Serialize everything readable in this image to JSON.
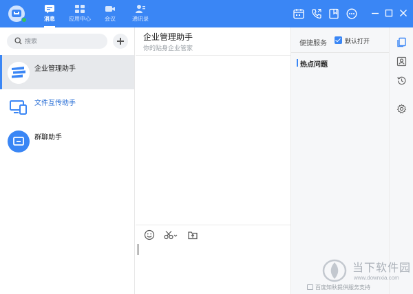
{
  "colors": {
    "brand": "#3a86f5",
    "online": "#33c25a",
    "selected_bg": "#e7e9ec"
  },
  "app": {
    "logo_icon": "chat-bubble-logo-icon",
    "status": "online"
  },
  "nav": [
    {
      "label": "消息",
      "icon": "message-icon",
      "active": true
    },
    {
      "label": "应用中心",
      "icon": "apps-grid-icon",
      "active": false
    },
    {
      "label": "会议",
      "icon": "video-camera-icon",
      "active": false
    },
    {
      "label": "通讯录",
      "icon": "contacts-icon",
      "active": false
    }
  ],
  "toolbar_icons": [
    "calendar-icon",
    "phone-icon",
    "bookmark-icon",
    "more-icon"
  ],
  "window_controls": [
    "minimize-icon",
    "maximize-icon",
    "close-icon"
  ],
  "search": {
    "placeholder": "搜索"
  },
  "conversations": [
    {
      "title": "企业管理助手",
      "icon": "enterprise-assistant-icon",
      "selected": true
    },
    {
      "title": "文件互传助手",
      "icon": "file-transfer-icon",
      "selected": false
    },
    {
      "title": "群聊助手",
      "icon": "group-chat-icon",
      "selected": false
    }
  ],
  "chat": {
    "title": "企业管理助手",
    "subtitle": "你的贴身企业管家",
    "tools": [
      "emoji-icon",
      "screenshot-scissors-icon",
      "upload-file-icon"
    ]
  },
  "right_panel": {
    "quick_service": "便捷服务",
    "default_open_label": "默认打开",
    "default_open_checked": true,
    "hot_issues": "热点问题",
    "rail_icons": [
      "documents-icon",
      "contact-card-icon",
      "history-icon",
      "settings-icon"
    ]
  },
  "watermark": {
    "brand": "当下软件园",
    "url": "www.downxia.com"
  },
  "footer": {
    "note": "百度知秋提供服务支持"
  }
}
